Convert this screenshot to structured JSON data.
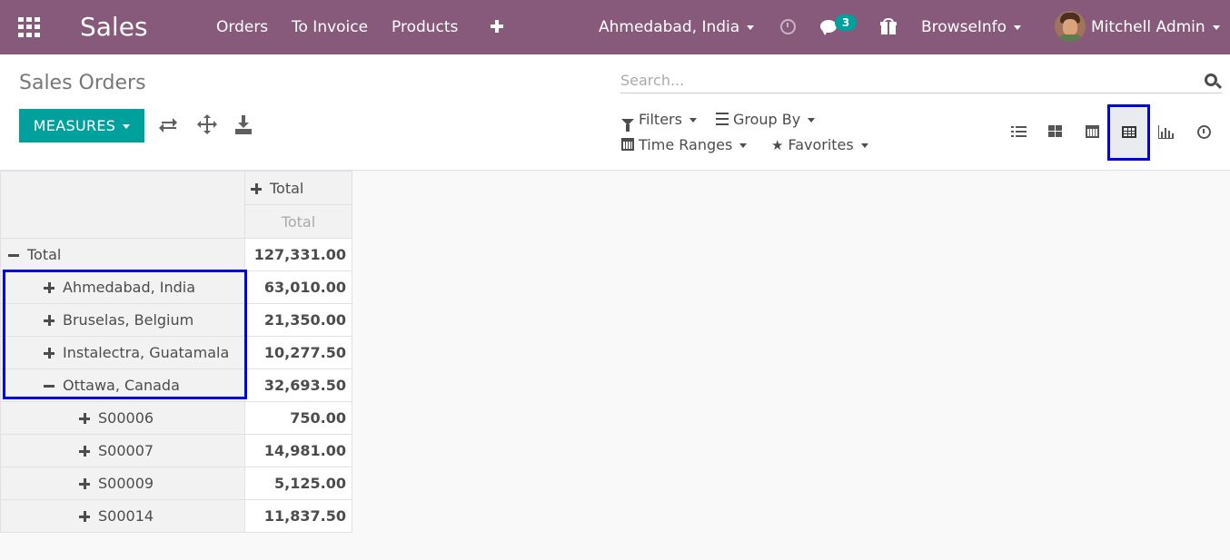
{
  "navbar": {
    "app_name": "Sales",
    "menu": [
      "Orders",
      "To Invoice",
      "Products"
    ],
    "company": "Ahmedabad, India",
    "messages_count": "3",
    "browseinfo": "BrowseInfo",
    "user": "Mitchell Admin",
    "bg_color": "#875a7b"
  },
  "control": {
    "title": "Sales Orders",
    "measures_label": "MEASURES",
    "search_placeholder": "Search...",
    "filters_label": "Filters",
    "groupby_label": "Group By",
    "timeranges_label": "Time Ranges",
    "favorites_label": "Favorites",
    "active_view": "pivot",
    "views": [
      "list",
      "kanban",
      "calendar",
      "pivot",
      "graph",
      "activity"
    ]
  },
  "pivot": {
    "col_header": "Total",
    "measure_header": "Total",
    "rows": [
      {
        "label": "Total",
        "value": "127,331.00",
        "level": 0,
        "expanded": true
      },
      {
        "label": "Ahmedabad, India",
        "value": "63,010.00",
        "level": 1,
        "expanded": false
      },
      {
        "label": "Bruselas, Belgium",
        "value": "21,350.00",
        "level": 1,
        "expanded": false
      },
      {
        "label": "Instalectra, Guatamala",
        "value": "10,277.50",
        "level": 1,
        "expanded": false
      },
      {
        "label": "Ottawa, Canada",
        "value": "32,693.50",
        "level": 1,
        "expanded": true
      },
      {
        "label": "S00006",
        "value": "750.00",
        "level": 2,
        "expanded": false
      },
      {
        "label": "S00007",
        "value": "14,981.00",
        "level": 2,
        "expanded": false
      },
      {
        "label": "S00009",
        "value": "5,125.00",
        "level": 2,
        "expanded": false
      },
      {
        "label": "S00014",
        "value": "11,837.50",
        "level": 2,
        "expanded": false
      }
    ]
  },
  "accent_color": "#00a09d",
  "highlight_color": "#0000e6"
}
